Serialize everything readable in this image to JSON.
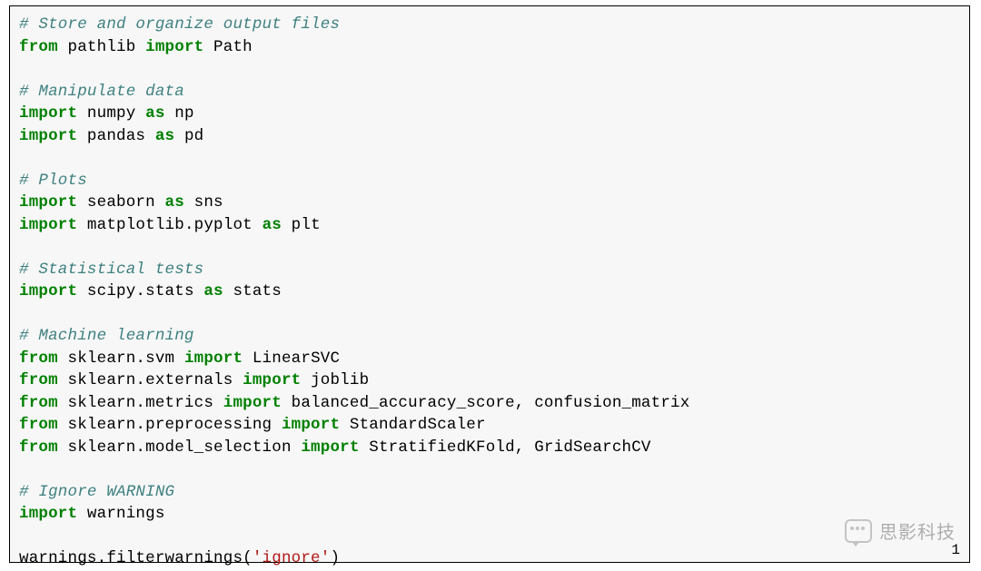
{
  "exec_count": "1",
  "watermark_text": "思影科技",
  "code": {
    "lines": [
      [
        {
          "cls": "c",
          "t": "# Store and organize output files"
        }
      ],
      [
        {
          "cls": "kn",
          "t": "from"
        },
        {
          "cls": "n",
          "t": " pathlib "
        },
        {
          "cls": "kn",
          "t": "import"
        },
        {
          "cls": "n",
          "t": " Path"
        }
      ],
      [
        {
          "cls": "n",
          "t": ""
        }
      ],
      [
        {
          "cls": "c",
          "t": "# Manipulate data"
        }
      ],
      [
        {
          "cls": "kn",
          "t": "import"
        },
        {
          "cls": "n",
          "t": " numpy "
        },
        {
          "cls": "kn",
          "t": "as"
        },
        {
          "cls": "n",
          "t": " np"
        }
      ],
      [
        {
          "cls": "kn",
          "t": "import"
        },
        {
          "cls": "n",
          "t": " pandas "
        },
        {
          "cls": "kn",
          "t": "as"
        },
        {
          "cls": "n",
          "t": " pd"
        }
      ],
      [
        {
          "cls": "n",
          "t": ""
        }
      ],
      [
        {
          "cls": "c",
          "t": "# Plots"
        }
      ],
      [
        {
          "cls": "kn",
          "t": "import"
        },
        {
          "cls": "n",
          "t": " seaborn "
        },
        {
          "cls": "kn",
          "t": "as"
        },
        {
          "cls": "n",
          "t": " sns"
        }
      ],
      [
        {
          "cls": "kn",
          "t": "import"
        },
        {
          "cls": "n",
          "t": " matplotlib.pyplot "
        },
        {
          "cls": "kn",
          "t": "as"
        },
        {
          "cls": "n",
          "t": " plt"
        }
      ],
      [
        {
          "cls": "n",
          "t": ""
        }
      ],
      [
        {
          "cls": "c",
          "t": "# Statistical tests"
        }
      ],
      [
        {
          "cls": "kn",
          "t": "import"
        },
        {
          "cls": "n",
          "t": " scipy.stats "
        },
        {
          "cls": "kn",
          "t": "as"
        },
        {
          "cls": "n",
          "t": " stats"
        }
      ],
      [
        {
          "cls": "n",
          "t": ""
        }
      ],
      [
        {
          "cls": "c",
          "t": "# Machine learning"
        }
      ],
      [
        {
          "cls": "kn",
          "t": "from"
        },
        {
          "cls": "n",
          "t": " sklearn.svm "
        },
        {
          "cls": "kn",
          "t": "import"
        },
        {
          "cls": "n",
          "t": " LinearSVC"
        }
      ],
      [
        {
          "cls": "kn",
          "t": "from"
        },
        {
          "cls": "n",
          "t": " sklearn.externals "
        },
        {
          "cls": "kn",
          "t": "import"
        },
        {
          "cls": "n",
          "t": " joblib"
        }
      ],
      [
        {
          "cls": "kn",
          "t": "from"
        },
        {
          "cls": "n",
          "t": " sklearn.metrics "
        },
        {
          "cls": "kn",
          "t": "import"
        },
        {
          "cls": "n",
          "t": " balanced_accuracy_score, confusion_matrix"
        }
      ],
      [
        {
          "cls": "kn",
          "t": "from"
        },
        {
          "cls": "n",
          "t": " sklearn.preprocessing "
        },
        {
          "cls": "kn",
          "t": "import"
        },
        {
          "cls": "n",
          "t": " StandardScaler"
        }
      ],
      [
        {
          "cls": "kn",
          "t": "from"
        },
        {
          "cls": "n",
          "t": " sklearn.model_selection "
        },
        {
          "cls": "kn",
          "t": "import"
        },
        {
          "cls": "n",
          "t": " StratifiedKFold, GridSearchCV"
        }
      ],
      [
        {
          "cls": "n",
          "t": ""
        }
      ],
      [
        {
          "cls": "c",
          "t": "# Ignore WARNING"
        }
      ],
      [
        {
          "cls": "kn",
          "t": "import"
        },
        {
          "cls": "n",
          "t": " warnings"
        }
      ],
      [
        {
          "cls": "n",
          "t": ""
        }
      ],
      [
        {
          "cls": "n",
          "t": "warnings.filterwarnings("
        },
        {
          "cls": "s",
          "t": "'ignore'"
        },
        {
          "cls": "n",
          "t": ")"
        }
      ]
    ]
  }
}
